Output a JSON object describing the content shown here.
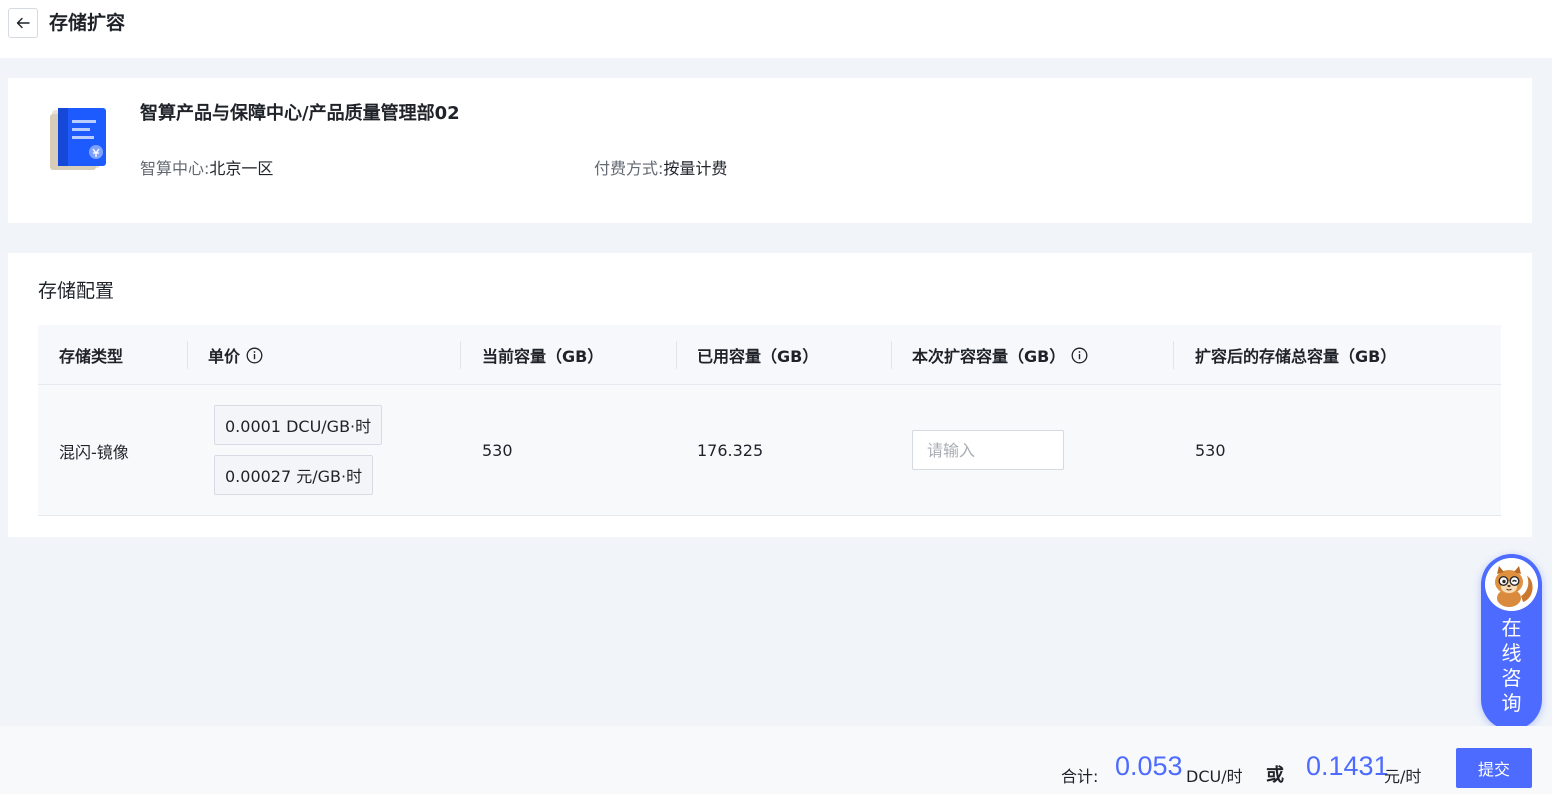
{
  "header": {
    "title": "存储扩容"
  },
  "product": {
    "name": "智算产品与保障中心/产品质量管理部02",
    "center_label": "智算中心:",
    "center_value": "北京一区",
    "billing_label": "付费方式:",
    "billing_value": "按量计费"
  },
  "storage": {
    "section_title": "存储配置",
    "columns": [
      "存储类型",
      "单价",
      "当前容量（GB）",
      "已用容量（GB）",
      "本次扩容容量（GB）",
      "扩容后的存储总容量（GB）"
    ],
    "row": {
      "type": "混闪-镜像",
      "price_dcu": "0.0001 DCU/GB·时",
      "price_yuan": "0.00027 元/GB·时",
      "current": "530",
      "used": "176.325",
      "expand_placeholder": "请输入",
      "total_after": "530"
    }
  },
  "footer": {
    "total_label": "合计:",
    "dcu_amount": "0.053",
    "dcu_unit": "DCU/时",
    "or_label": "或",
    "yuan_amount": "0.1431",
    "yuan_unit": "元/时",
    "submit_label": "提交"
  },
  "consult": {
    "text": "在线咨询"
  },
  "colors": {
    "accent": "#4d6bfe",
    "page_bg": "#f1f4f9"
  }
}
